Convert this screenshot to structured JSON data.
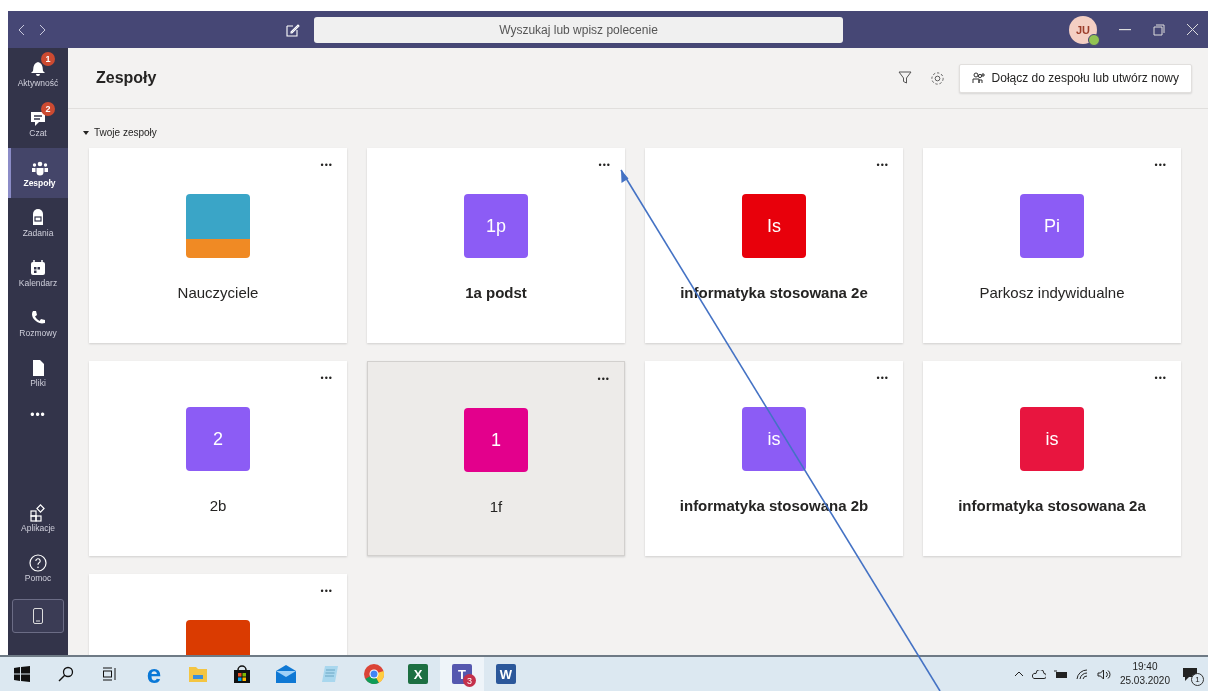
{
  "titlebar": {
    "search_placeholder": "Wyszukaj lub wpisz polecenie",
    "avatar_initials": "JU",
    "online": true
  },
  "sidebar": {
    "items": [
      {
        "label": "Aktywność",
        "badge": "1",
        "selected": false
      },
      {
        "label": "Czat",
        "badge": "2",
        "selected": false
      },
      {
        "label": "Zespoły",
        "selected": true
      },
      {
        "label": "Zadania",
        "selected": false
      },
      {
        "label": "Kalendarz",
        "selected": false
      },
      {
        "label": "Rozmowy",
        "selected": false
      },
      {
        "label": "Pliki",
        "selected": false
      }
    ],
    "more": "•••",
    "bottom_items": [
      {
        "label": "Aplikacje"
      },
      {
        "label": "Pomoc"
      }
    ]
  },
  "header": {
    "title": "Zespoły",
    "join_button": "Dołącz do zespołu lub utwórz nowy"
  },
  "section": {
    "label": "Twoje zespoły",
    "expanded": true
  },
  "teams": [
    {
      "name": "Nauczyciele",
      "kind": "image",
      "unread": false,
      "hovered": false
    },
    {
      "name": "1a podst",
      "kind": "initials",
      "initials": "1p",
      "color": "#8c5cf5",
      "unread": true,
      "hovered": false
    },
    {
      "name": "informatyka stosowana 2e",
      "kind": "initials",
      "initials": "Is",
      "color": "#e8000b",
      "unread": true,
      "hovered": false
    },
    {
      "name": "Parkosz indywidualne",
      "kind": "initials",
      "initials": "Pi",
      "color": "#8c5cf5",
      "unread": false,
      "hovered": false
    },
    {
      "name": "2b",
      "kind": "initials",
      "initials": "2",
      "color": "#8c5cf5",
      "unread": false,
      "hovered": false
    },
    {
      "name": "1f",
      "kind": "initials",
      "initials": "1",
      "color": "#e3008c",
      "unread": false,
      "hovered": true
    },
    {
      "name": "informatyka stosowana 2b",
      "kind": "initials",
      "initials": "is",
      "color": "#8c5cf5",
      "unread": true,
      "hovered": false
    },
    {
      "name": "informatyka stosowana 2a",
      "kind": "initials",
      "initials": "is",
      "color": "#e8153f",
      "unread": true,
      "hovered": false
    },
    {
      "kind": "initials",
      "color": "#da3b01",
      "hovered": false
    }
  ],
  "more_options": "•••",
  "taskbar": {
    "apps": [
      {
        "kind": "browser-e",
        "glyph": "e",
        "active": false
      },
      {
        "kind": "folder",
        "active": false
      },
      {
        "kind": "bag",
        "active": false
      },
      {
        "kind": "mail",
        "active": false
      },
      {
        "kind": "notepad",
        "active": false
      },
      {
        "kind": "chrome",
        "active": false
      },
      {
        "kind": "tile",
        "glyph": "X",
        "color": "#1d6f42",
        "active": false
      },
      {
        "kind": "tile",
        "glyph": "T",
        "color": "#5558af",
        "badge": "3",
        "active": true
      },
      {
        "kind": "tile",
        "glyph": "W",
        "color": "#2b579a",
        "active": false
      }
    ],
    "time": "19:40",
    "date": "25.03.2020",
    "notifications": "1"
  }
}
